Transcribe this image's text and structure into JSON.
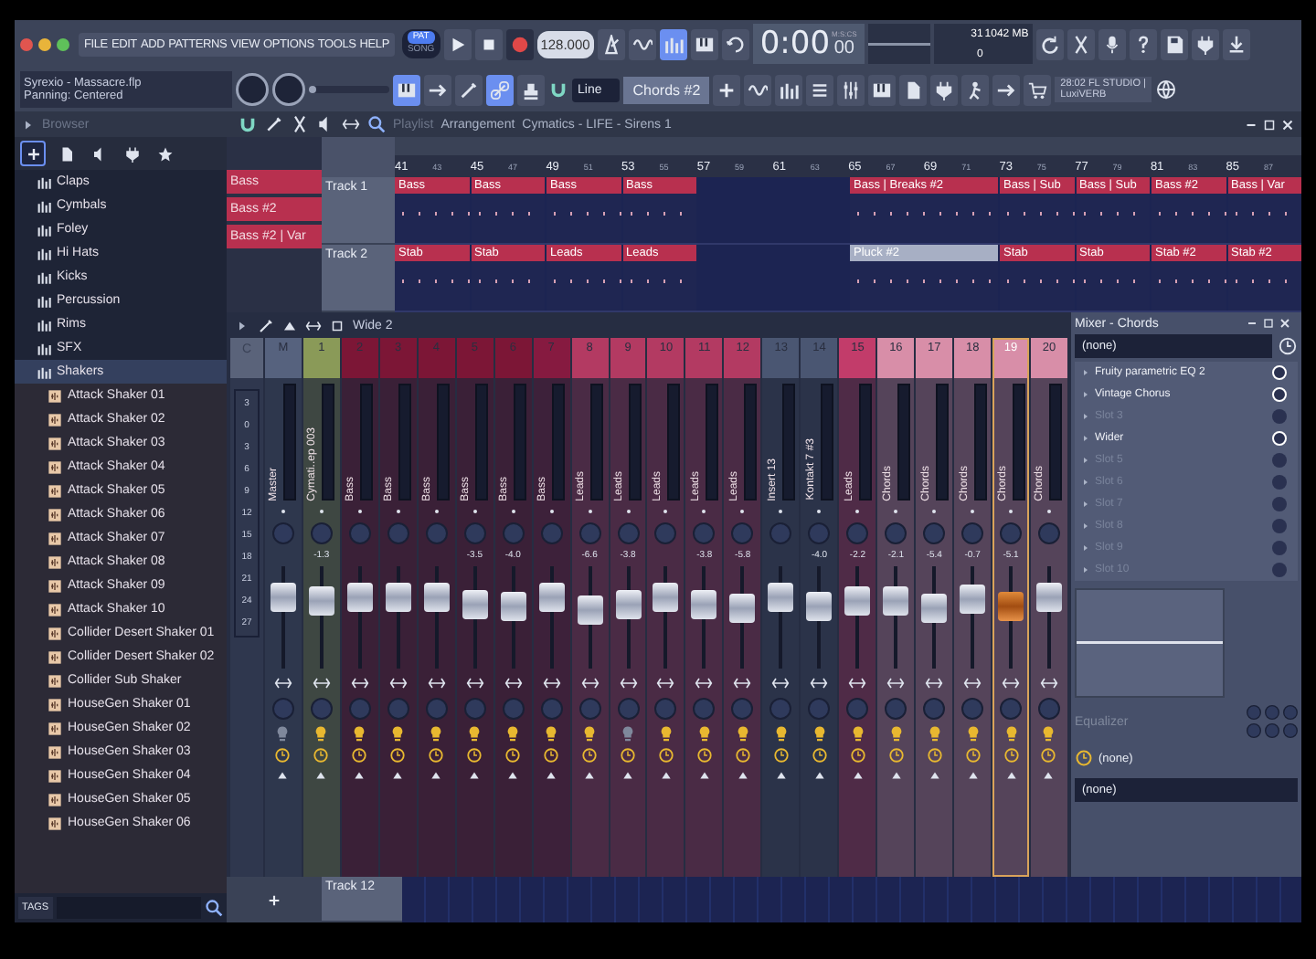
{
  "menu": [
    "FILE",
    "EDIT",
    "ADD",
    "PATTERNS",
    "VIEW",
    "OPTIONS",
    "TOOLS",
    "HELP"
  ],
  "transport": {
    "modes": [
      {
        "label": "PAT",
        "selected": true
      },
      {
        "label": "SONG",
        "selected": false
      }
    ],
    "tempo": "128.000",
    "time": "0:00",
    "time_fraction": "00",
    "time_unit": "M:S:CS"
  },
  "monitor": {
    "cpu": "31",
    "memory": "1042 MB",
    "polyphony": "0"
  },
  "hint": {
    "title": "Syrexio - Massacre.flp",
    "text": "Panning: Centered"
  },
  "master_volume": {
    "level": 0.08
  },
  "snap": "Line",
  "pattern": "Chords #2",
  "news": {
    "line_1": "28:02 FL STUDIO |",
    "line_2": "LuxiVERB"
  },
  "browser": {
    "title": "Browser",
    "tabs": [
      {
        "selected": true
      },
      {
        "selected": false
      },
      {
        "selected": false
      },
      {
        "selected": false
      },
      {
        "selected": false
      }
    ],
    "folders": [
      {
        "label": "Claps",
        "selected": false
      },
      {
        "label": "Cymbals",
        "selected": false
      },
      {
        "label": "Foley",
        "selected": false
      },
      {
        "label": "Hi Hats",
        "selected": false
      },
      {
        "label": "Kicks",
        "selected": false
      },
      {
        "label": "Percussion",
        "selected": false
      },
      {
        "label": "Rims",
        "selected": false
      },
      {
        "label": "SFX",
        "selected": false
      },
      {
        "label": "Shakers",
        "selected": true,
        "children": [
          "Attack Shaker 01",
          "Attack Shaker 02",
          "Attack Shaker 03",
          "Attack Shaker 04",
          "Attack Shaker 05",
          "Attack Shaker 06",
          "Attack Shaker 07",
          "Attack Shaker 08",
          "Attack Shaker 09",
          "Attack Shaker 10",
          "Collider Desert Shaker 01",
          "Collider Desert Shaker 02",
          "Collider Sub Shaker",
          "HouseGen Shaker 01",
          "HouseGen Shaker 02",
          "HouseGen Shaker 03",
          "HouseGen Shaker 04",
          "HouseGen Shaker 05",
          "HouseGen Shaker 06"
        ]
      }
    ],
    "tags": "TAGS"
  },
  "playlist": {
    "path": [
      "Playlist",
      "Arrangement",
      "Cymatics - LIFE - Sirens 1"
    ],
    "patterns": [
      "Bass",
      "Bass #2",
      "Bass #2 | Var"
    ],
    "ruler": [
      "41",
      "43",
      "45",
      "47",
      "49",
      "51",
      "53",
      "55",
      "57",
      "59",
      "61",
      "63",
      "65",
      "67",
      "69",
      "71",
      "73",
      "75",
      "77",
      "79",
      "81",
      "83",
      "85",
      "87"
    ],
    "tracks": [
      {
        "name": "Track 1",
        "clips": [
          {
            "kind": "clip",
            "label": "Bass",
            "color": "#b8304f"
          },
          {
            "kind": "clip",
            "label": "Bass",
            "color": "#b8304f"
          },
          {
            "kind": "clip",
            "label": "Bass",
            "color": "#b8304f"
          },
          {
            "kind": "clip",
            "label": "Bass",
            "color": "#b8304f"
          },
          {
            "kind": "empty"
          },
          {
            "kind": "empty"
          },
          {
            "kind": "long",
            "label": "Bass | Breaks #2",
            "color": "#b8304f"
          },
          {
            "kind": "clip",
            "label": "Bass | Sub",
            "color": "#b8304f"
          },
          {
            "kind": "clip",
            "label": "Bass | Sub",
            "color": "#b8304f"
          },
          {
            "kind": "clip",
            "label": "Bass #2",
            "color": "#b8304f"
          },
          {
            "kind": "clip",
            "label": "Bass | Var",
            "color": "#b8304f"
          }
        ]
      },
      {
        "name": "Track 2",
        "clips": [
          {
            "kind": "clip",
            "label": "Stab",
            "color": "#b8304f"
          },
          {
            "kind": "clip",
            "label": "Stab",
            "color": "#b8304f"
          },
          {
            "kind": "clip",
            "label": "Leads",
            "color": "#b8304f"
          },
          {
            "kind": "clip",
            "label": "Leads",
            "color": "#b8304f"
          },
          {
            "kind": "empty"
          },
          {
            "kind": "empty"
          },
          {
            "kind": "long",
            "label": "Pluck #2",
            "color": "#a7afc4"
          },
          {
            "kind": "clip",
            "label": "Stab",
            "color": "#b8304f"
          },
          {
            "kind": "clip",
            "label": "Stab",
            "color": "#b8304f"
          },
          {
            "kind": "clip",
            "label": "Stab #2",
            "color": "#b8304f"
          },
          {
            "kind": "clip",
            "label": "Stab #2",
            "color": "#b8304f"
          }
        ]
      }
    ],
    "bottom_track": "Track 12"
  },
  "mixer": {
    "preset": "Wide 2",
    "scale_header": "C",
    "scale": [
      "3",
      "0",
      "3",
      "6",
      "9",
      "12",
      "15",
      "18",
      "21",
      "24",
      "27"
    ],
    "strips": [
      {
        "number": "M",
        "name": "Master",
        "color": "#56627e",
        "level": 0.78,
        "active": false,
        "selected": false
      },
      {
        "number": "1",
        "name": "Cymati..ep 003",
        "color": "#8a9a58",
        "reading": "-1.3",
        "level": 0.72,
        "active": true,
        "selected": false
      },
      {
        "number": "2",
        "name": "Bass",
        "color": "#7c1636",
        "level": 0.78,
        "active": true,
        "selected": false
      },
      {
        "number": "3",
        "name": "Bass",
        "color": "#7c1636",
        "level": 0.78,
        "active": true,
        "selected": false
      },
      {
        "number": "4",
        "name": "Bass",
        "color": "#7c1636",
        "level": 0.78,
        "active": true,
        "selected": false
      },
      {
        "number": "5",
        "name": "Bass",
        "color": "#7c1636",
        "reading": "-3.5",
        "level": 0.68,
        "active": true,
        "selected": false
      },
      {
        "number": "6",
        "name": "Bass",
        "color": "#7c1636",
        "reading": "-4.0",
        "level": 0.66,
        "active": true,
        "selected": false
      },
      {
        "number": "7",
        "name": "Bass",
        "color": "#861a40",
        "level": 0.78,
        "active": true,
        "selected": false
      },
      {
        "number": "8",
        "name": "Leads",
        "color": "#b33a62",
        "reading": "-6.6",
        "level": 0.6,
        "active": true,
        "selected": false
      },
      {
        "number": "9",
        "name": "Leads",
        "color": "#b33a62",
        "reading": "-3.8",
        "level": 0.68,
        "active": false,
        "selected": false
      },
      {
        "number": "10",
        "name": "Leads",
        "color": "#b33a62",
        "level": 0.78,
        "active": true,
        "selected": false
      },
      {
        "number": "11",
        "name": "Leads",
        "color": "#b33a62",
        "reading": "-3.8",
        "level": 0.68,
        "active": true,
        "selected": false
      },
      {
        "number": "12",
        "name": "Leads",
        "color": "#b33a62",
        "reading": "-5.8",
        "level": 0.62,
        "active": true,
        "selected": false
      },
      {
        "number": "13",
        "name": "Insert 13",
        "color": "#4a5672",
        "level": 0.78,
        "active": true,
        "selected": false
      },
      {
        "number": "14",
        "name": "Kontakt 7 #3",
        "color": "#4a5672",
        "reading": "-4.0",
        "level": 0.66,
        "active": true,
        "selected": false
      },
      {
        "number": "15",
        "name": "Leads",
        "color": "#c23c6a",
        "reading": "-2.2",
        "level": 0.72,
        "active": true,
        "selected": false
      },
      {
        "number": "16",
        "name": "Chords",
        "color": "#d88ea8",
        "reading": "-2.1",
        "level": 0.72,
        "active": true,
        "selected": false
      },
      {
        "number": "17",
        "name": "Chords",
        "color": "#d88ea8",
        "reading": "-5.4",
        "level": 0.63,
        "active": true,
        "selected": false
      },
      {
        "number": "18",
        "name": "Chords",
        "color": "#d88ea8",
        "reading": "-0.7",
        "level": 0.76,
        "active": true,
        "selected": false
      },
      {
        "number": "19",
        "name": "Chords",
        "color": "#d88ea8",
        "reading": "-5.1",
        "level": 0.64,
        "active": true,
        "selected": true
      },
      {
        "number": "20",
        "name": "Chords",
        "color": "#d88ea8",
        "level": 0.78,
        "active": true,
        "selected": false
      }
    ]
  },
  "mixer_panel": {
    "title": "Mixer - Chords",
    "input": "(none)",
    "slots": [
      {
        "label": "Fruity parametric EQ 2",
        "on": true
      },
      {
        "label": "Vintage Chorus",
        "on": true
      },
      {
        "label": "Slot 3",
        "on": false
      },
      {
        "label": "Wider",
        "on": true
      },
      {
        "label": "Slot 5",
        "on": false
      },
      {
        "label": "Slot 6",
        "on": false
      },
      {
        "label": "Slot 7",
        "on": false
      },
      {
        "label": "Slot 8",
        "on": false
      },
      {
        "label": "Slot 9",
        "on": false
      },
      {
        "label": "Slot 10",
        "on": false
      }
    ],
    "eq_label": "Equalizer",
    "output_1": "(none)",
    "output_2": "(none)"
  }
}
